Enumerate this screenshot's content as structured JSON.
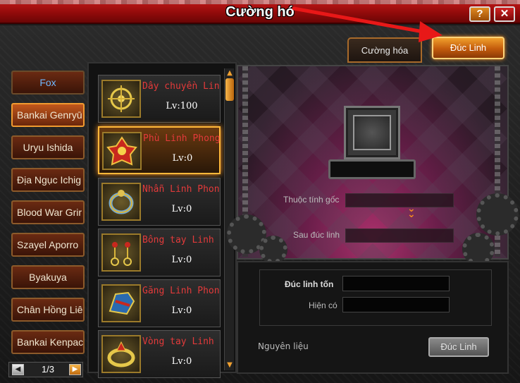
{
  "window": {
    "title": "Cường hó",
    "help_label": "?",
    "close_label": "✕"
  },
  "tabs": [
    {
      "label": "Cường hóa",
      "active": false
    },
    {
      "label": "Đúc Linh",
      "active": true
    }
  ],
  "characters": [
    {
      "label": "Fox"
    },
    {
      "label": "Bankai Genryū",
      "selected": true
    },
    {
      "label": "Uryu Ishida"
    },
    {
      "label": "Địa Ngục Ichig"
    },
    {
      "label": "Blood War Grir"
    },
    {
      "label": "Szayel Aporro"
    },
    {
      "label": "Byakuya"
    },
    {
      "label": "Chân Hồng Liê"
    },
    {
      "label": "Bankai Kenpac"
    }
  ],
  "pager": {
    "text": "1/3",
    "prev_icon": "◀",
    "next_icon": "▶"
  },
  "items": [
    {
      "name": "Dây chuyền Lin",
      "level": "Lv:100",
      "icon": "necklace-icon"
    },
    {
      "name": "Phù Linh Phong",
      "level": "Lv:0",
      "icon": "talisman-icon",
      "selected": true
    },
    {
      "name": "Nhẫn Linh Phon",
      "level": "Lv:0",
      "icon": "ring-icon"
    },
    {
      "name": "Bông tay Linh",
      "level": "Lv:0",
      "icon": "earring-icon"
    },
    {
      "name": "Găng Linh Phon",
      "level": "Lv:0",
      "icon": "glove-icon"
    },
    {
      "name": "Vòng tay Linh",
      "level": "Lv:0",
      "icon": "bracelet-icon"
    }
  ],
  "forge": {
    "attr_origin_label": "Thuộc tính gốc",
    "after_label": "Sau đúc linh",
    "cost_label": "Đúc linh tốn",
    "have_label": "Hiện có",
    "material_label": "Nguyên liệu",
    "button_label": "Đúc Linh"
  },
  "colors": {
    "item_name": "#e33a3a",
    "accent_orange": "#f0a02c",
    "arrow": "#e81818"
  }
}
